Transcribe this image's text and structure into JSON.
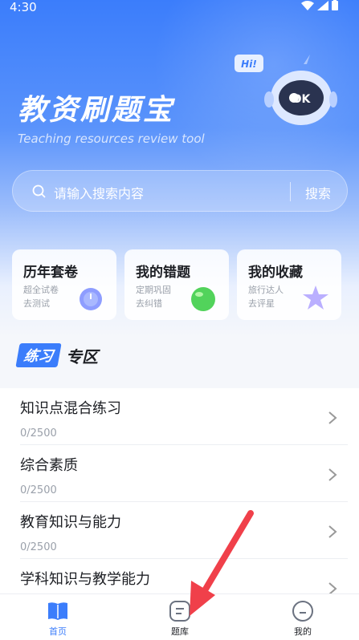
{
  "status_bar": {
    "time": "4:30"
  },
  "header": {
    "title": "教资刷题宝",
    "subtitle": "Teaching resources review tool",
    "mascot_bubble": "Hi!",
    "mascot_eyes": "OK"
  },
  "search": {
    "placeholder": "请输入搜索内容",
    "button_label": "搜索"
  },
  "quick_cards": [
    {
      "title": "历年套卷",
      "line1": "超全试卷",
      "line2": "去测试",
      "icon": "stopwatch-icon"
    },
    {
      "title": "我的错题",
      "line1": "定期巩固",
      "line2": "去纠错",
      "icon": "green-orb-icon"
    },
    {
      "title": "我的收藏",
      "line1": "旅行达人",
      "line2": "去评星",
      "icon": "star-icon"
    }
  ],
  "section": {
    "badge": "练习",
    "rest": "专区"
  },
  "practice_list": [
    {
      "title": "知识点混合练习",
      "progress": "0/2500"
    },
    {
      "title": "综合素质",
      "progress": "0/2500"
    },
    {
      "title": "教育知识与能力",
      "progress": "0/2500"
    },
    {
      "title": "学科知识与教学能力",
      "progress": ""
    }
  ],
  "tabs": [
    {
      "label": "首页",
      "active": true
    },
    {
      "label": "题库",
      "active": false
    },
    {
      "label": "我的",
      "active": false
    }
  ],
  "colors": {
    "accent": "#3b7dfb",
    "text": "#1d1f24",
    "muted": "#9aa0aa",
    "arrow": "#f0404a"
  }
}
